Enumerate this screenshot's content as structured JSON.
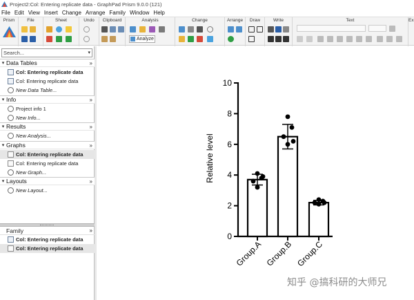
{
  "window": {
    "title": "Project2:Col: Entering replicate data - GraphPad Prism 9.0.0 (121)"
  },
  "menu": [
    "File",
    "Edit",
    "View",
    "Insert",
    "Change",
    "Arrange",
    "Family",
    "Window",
    "Help"
  ],
  "toolbar": {
    "groups": [
      "Prism",
      "File",
      "Sheet",
      "Undo",
      "Clipboard",
      "Analysis",
      "Change",
      "Arrange",
      "Draw",
      "Write",
      "Text",
      "Ex"
    ],
    "analyze_label": "Analyze"
  },
  "sidebar": {
    "search_placeholder": "Search...",
    "sections": [
      {
        "label": "Data Tables",
        "items": [
          {
            "label": "Col: Entering replicate data",
            "style": "bold"
          },
          {
            "label": "Col: Entering replicate data",
            "style": "normal"
          },
          {
            "label": "New Data Table...",
            "style": "italic"
          }
        ]
      },
      {
        "label": "Info",
        "items": [
          {
            "label": "Project info 1",
            "style": "normal"
          },
          {
            "label": "New Info...",
            "style": "italic"
          }
        ]
      },
      {
        "label": "Results",
        "items": [
          {
            "label": "New Analysis...",
            "style": "italic"
          }
        ]
      },
      {
        "label": "Graphs",
        "items": [
          {
            "label": "Col: Entering replicate data",
            "style": "bold"
          },
          {
            "label": "Col: Entering replicate data",
            "style": "normal"
          },
          {
            "label": "New Graph...",
            "style": "italic"
          }
        ]
      },
      {
        "label": "Layouts",
        "items": [
          {
            "label": "New Layout...",
            "style": "italic"
          }
        ]
      }
    ],
    "family": {
      "label": "Family",
      "items": [
        {
          "label": "Col: Entering replicate data"
        },
        {
          "label": "Col: Entering replicate data"
        }
      ]
    }
  },
  "watermark": "知乎 @搞科研的大师兄",
  "chart_data": {
    "type": "bar",
    "categories": [
      "Group.A",
      "Group.B",
      "Group.C"
    ],
    "values": [
      3.7,
      6.5,
      2.2
    ],
    "errors": [
      0.35,
      0.8,
      0.15
    ],
    "points": [
      [
        4.1,
        3.8,
        3.6,
        3.2,
        3.9
      ],
      [
        7.8,
        7.1,
        6.5,
        6.0,
        6.2
      ],
      [
        2.4,
        2.3,
        2.2,
        2.1,
        2.2
      ]
    ],
    "ylabel": "Relative level",
    "xlabel": "",
    "ylim": [
      0,
      10
    ],
    "yticks": [
      0,
      2,
      4,
      6,
      8,
      10
    ]
  }
}
